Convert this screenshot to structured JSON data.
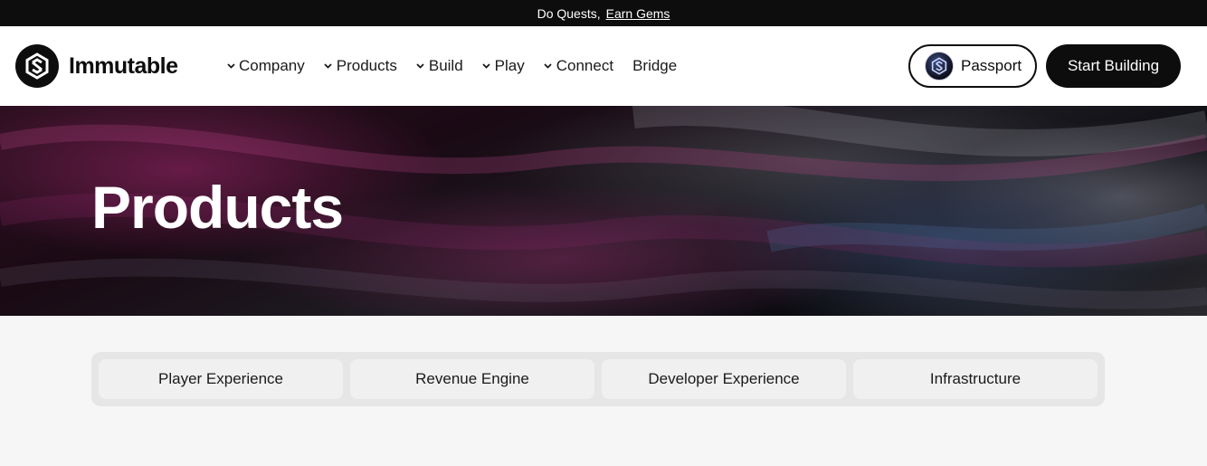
{
  "announcement": {
    "lead": "Do Quests,",
    "link": "Earn Gems"
  },
  "brand": {
    "name": "Immutable",
    "icon": "immutable-logo-icon"
  },
  "nav": {
    "items": [
      {
        "label": "Company",
        "has_dropdown": true
      },
      {
        "label": "Products",
        "has_dropdown": true
      },
      {
        "label": "Build",
        "has_dropdown": true
      },
      {
        "label": "Play",
        "has_dropdown": true
      },
      {
        "label": "Connect",
        "has_dropdown": true
      },
      {
        "label": "Bridge",
        "has_dropdown": false
      }
    ]
  },
  "header_actions": {
    "passport_label": "Passport",
    "passport_icon": "passport-logo-icon",
    "start_label": "Start Building"
  },
  "hero": {
    "title": "Products"
  },
  "tabs": [
    {
      "label": "Player Experience"
    },
    {
      "label": "Revenue Engine"
    },
    {
      "label": "Developer Experience"
    },
    {
      "label": "Infrastructure"
    }
  ],
  "colors": {
    "primary": "#0d0d0d",
    "background": "#f6f6f6",
    "tab_container": "#e6e6e6",
    "tab": "#f0f0f0"
  }
}
